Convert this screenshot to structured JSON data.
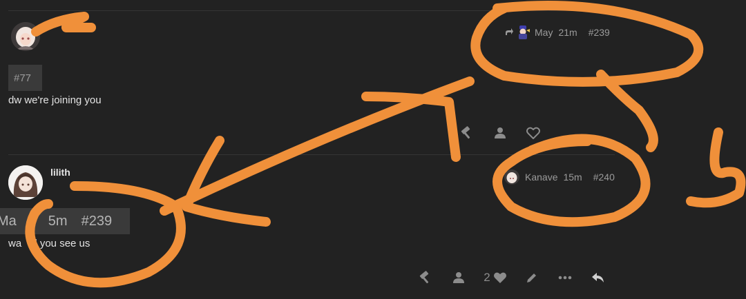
{
  "post_top": {
    "reply_to_number": "#77",
    "reply_author": "May",
    "time": "21m",
    "post_number": "#239",
    "body": "dw we're joining you"
  },
  "post_bottom": {
    "username": "lilith",
    "reply_to_author": "Kanave",
    "time": "15m",
    "post_number": "#240",
    "quote_author": "Ma",
    "quote_time": "5m",
    "quote_number": "#239",
    "body": "wa  till you see us",
    "like_count": "2"
  },
  "icons": {
    "admin": "hammer-icon",
    "user": "user-icon",
    "like": "heart-icon",
    "edit": "pencil-icon",
    "more": "ellipsis-icon",
    "reply": "reply-icon",
    "share": "share-arrow-icon"
  },
  "colors": {
    "background": "#222222",
    "annotation": "#f0903a",
    "muted_text": "#9b9b9b"
  }
}
